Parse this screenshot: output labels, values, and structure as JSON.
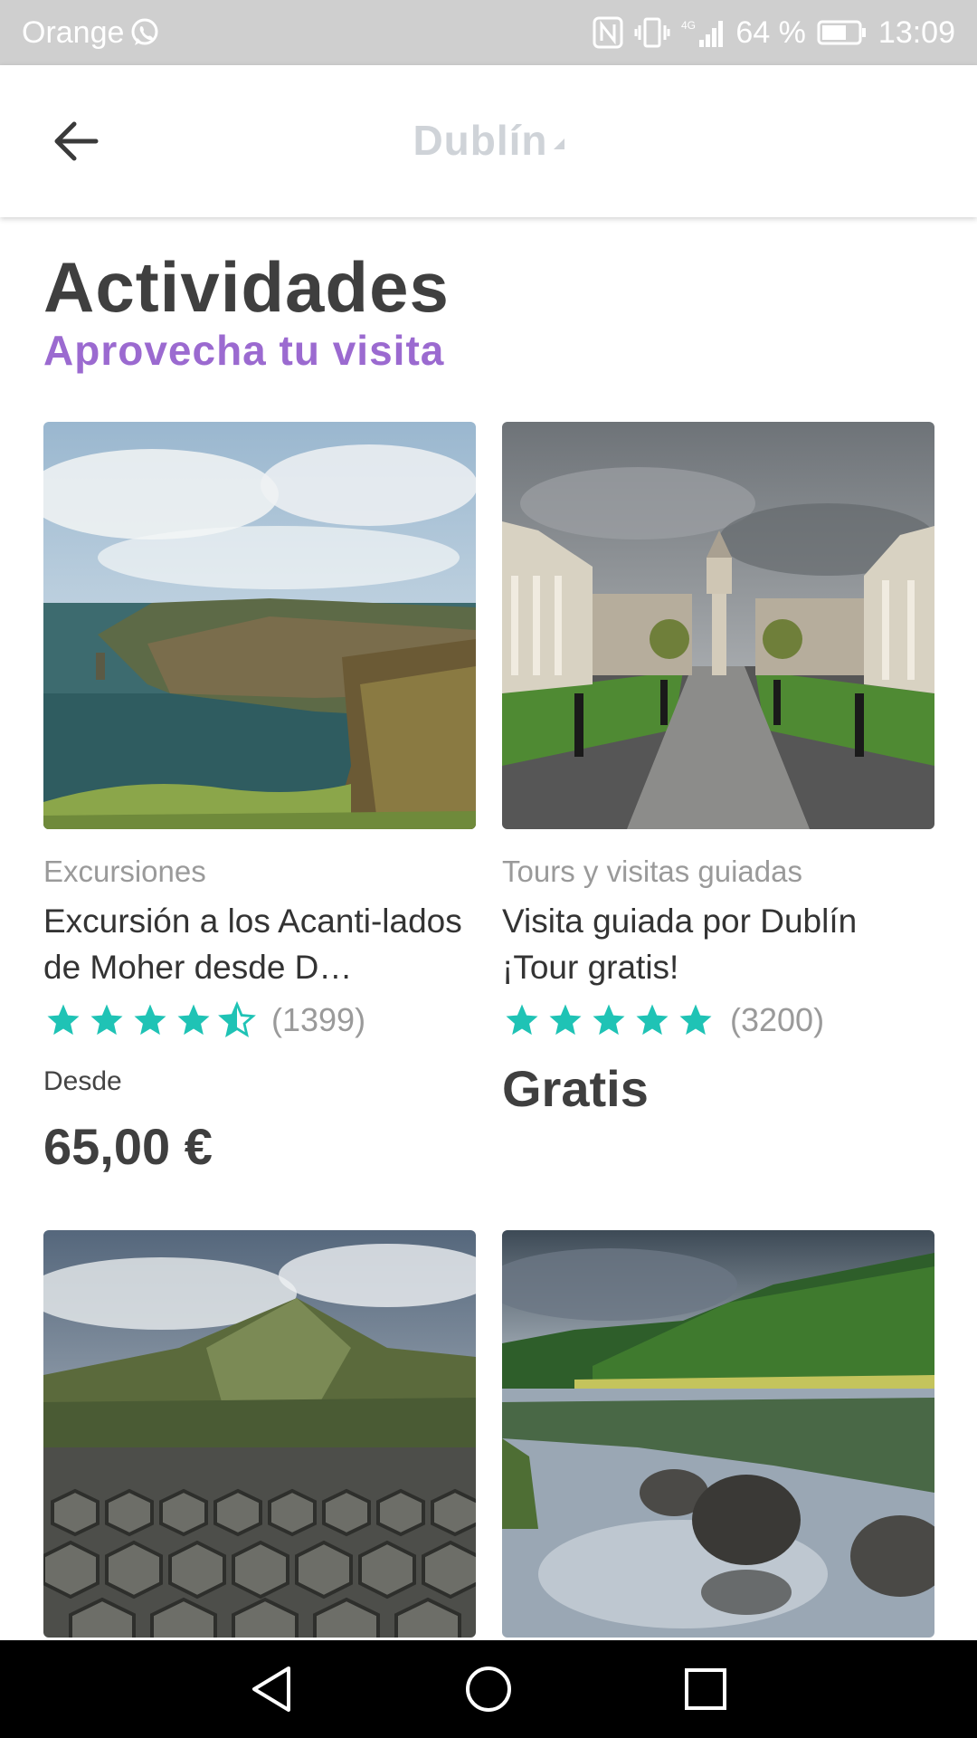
{
  "status_bar": {
    "carrier": "Orange",
    "battery": "64 %",
    "time": "13:09",
    "network": "4G",
    "icons": [
      "whatsapp-icon",
      "nfc-icon",
      "vibrate-icon",
      "signal-icon",
      "battery-icon"
    ]
  },
  "app_bar": {
    "title": "Dublín",
    "back_icon": "arrow-left-icon"
  },
  "section": {
    "title": "Actividades",
    "subtitle": "Aprovecha tu visita"
  },
  "colors": {
    "accent_purple": "#9b6ad0",
    "star_teal": "#1fc3b5",
    "title_gray": "#cfd3d8"
  },
  "cards": [
    {
      "category": "Excursiones",
      "title": "Excursión a los Acanti-lados de Moher desde D…",
      "rating": 4.5,
      "reviews": "(1399)",
      "from_label": "Desde",
      "price": "65,00 €",
      "image": "cliffs-of-moher-photo"
    },
    {
      "category": "Tours y visitas guiadas",
      "title": "Visita guiada por Dublín ¡Tour gratis!",
      "rating": 5,
      "reviews": "(3200)",
      "price": "Gratis",
      "image": "trinity-college-photo"
    },
    {
      "image": "giants-causeway-photo"
    },
    {
      "image": "glendalough-lake-photo"
    }
  ],
  "nav_bar": {
    "icons": [
      "back-triangle-icon",
      "home-circle-icon",
      "recents-square-icon"
    ]
  }
}
